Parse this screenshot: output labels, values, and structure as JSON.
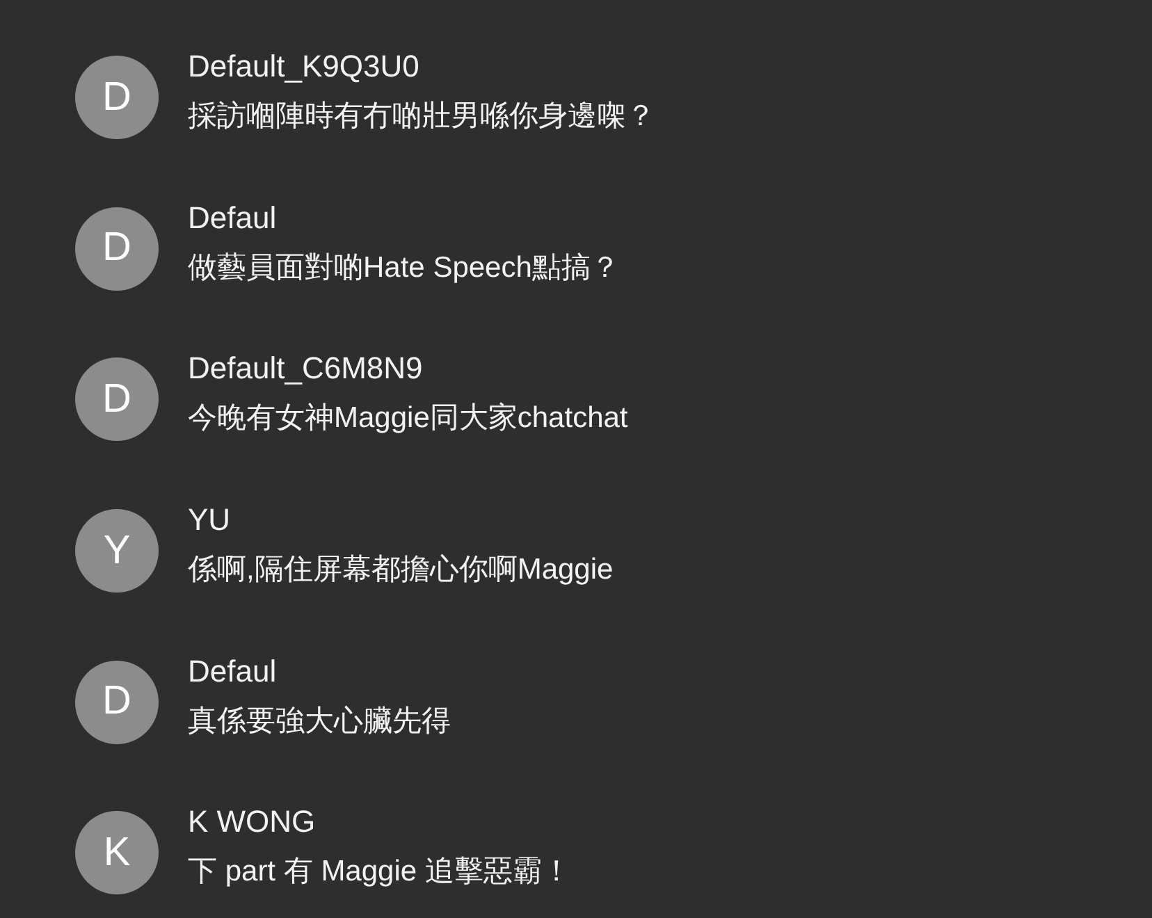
{
  "messages": [
    {
      "avatar": "D",
      "name": "Default_K9Q3U0",
      "text": "採訪嗰陣時有冇啲壯男喺你身邊㗎？"
    },
    {
      "avatar": "D",
      "name": "Defaul",
      "text": "做藝員面對啲Hate Speech點搞？"
    },
    {
      "avatar": "D",
      "name": "Default_C6M8N9",
      "text": "今晚有女神Maggie同大家chatchat"
    },
    {
      "avatar": "Y",
      "name": "YU",
      "text": "係啊,隔住屏幕都擔心你啊Maggie"
    },
    {
      "avatar": "D",
      "name": "Defaul",
      "text": "真係要強大心臟先得"
    },
    {
      "avatar": "K",
      "name": "K WONG",
      "text": "下 part 有 Maggie 追擊惡霸！"
    }
  ]
}
